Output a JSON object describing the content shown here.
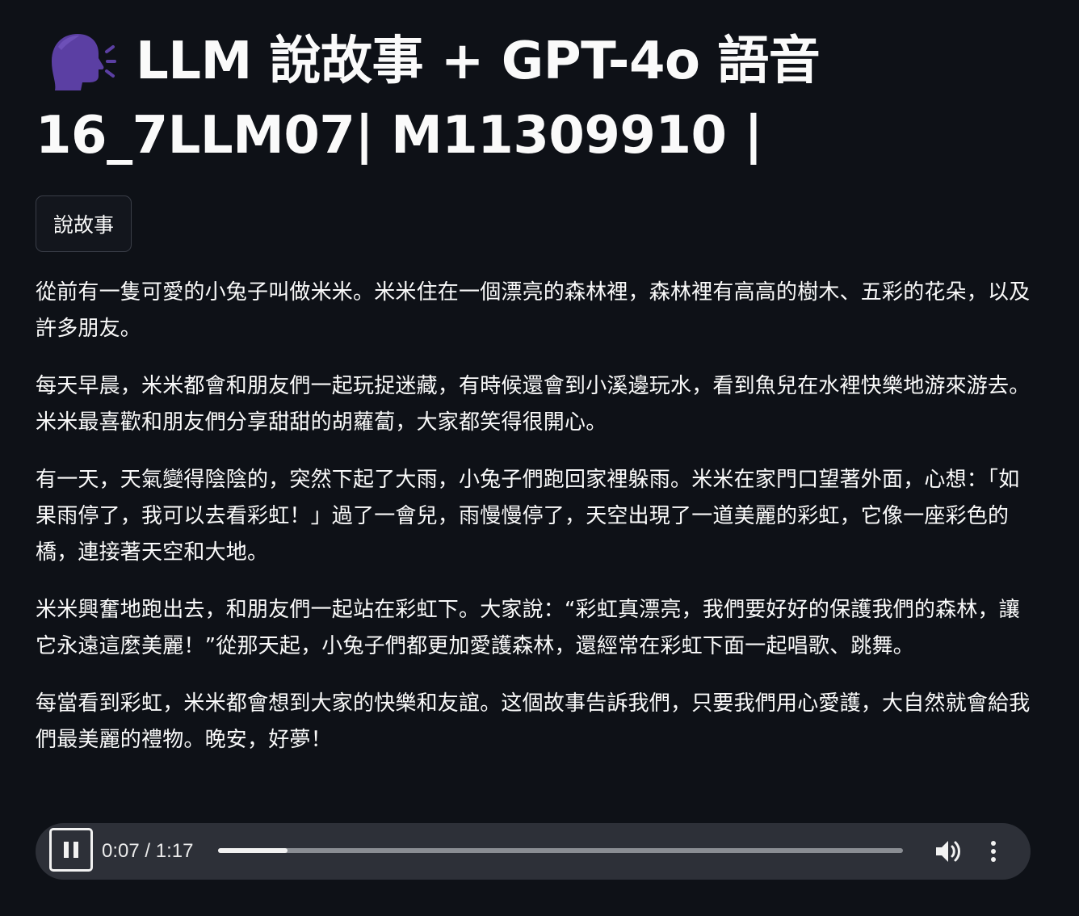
{
  "header": {
    "icon": "speaking-head-icon",
    "title_line1": "LLM 說故事 + GPT-4o 語音",
    "title_line2": "16_7LLM07| M11309910 |"
  },
  "actions": {
    "story_button_label": "說故事"
  },
  "story": {
    "paragraphs": [
      "從前有一隻可愛的小兔子叫做米米。米米住在一個漂亮的森林裡，森林裡有高高的樹木、五彩的花朵，以及許多朋友。",
      "每天早晨，米米都會和朋友們一起玩捉迷藏，有時候還會到小溪邊玩水，看到魚兒在水裡快樂地游來游去。米米最喜歡和朋友們分享甜甜的胡蘿蔔，大家都笑得很開心。",
      "有一天，天氣變得陰陰的，突然下起了大雨，小兔子們跑回家裡躲雨。米米在家門口望著外面，心想：「如果雨停了，我可以去看彩虹！」過了一會兒，雨慢慢停了，天空出現了一道美麗的彩虹，它像一座彩色的橋，連接著天空和大地。",
      "米米興奮地跑出去，和朋友們一起站在彩虹下。大家說：“彩虹真漂亮，我們要好好的保護我們的森林，讓它永遠這麼美麗！”從那天起，小兔子們都更加愛護森林，還經常在彩虹下面一起唱歌、跳舞。",
      "每當看到彩虹，米米都會想到大家的快樂和友誼。这個故事告訴我們，只要我們用心愛護，大自然就會給我們最美麗的禮物。晚安，好夢！"
    ]
  },
  "audio": {
    "time_text": "0:07 / 1:17",
    "progress_fraction": 0.101,
    "state": "playing",
    "play_icon": "pause-icon",
    "volume_icon": "volume-icon",
    "menu_icon": "more-vertical-icon"
  },
  "colors": {
    "background": "#0e1117",
    "text": "#fafafa",
    "player_background": "#2d3038",
    "icon_purple": "#5b3fa3"
  }
}
